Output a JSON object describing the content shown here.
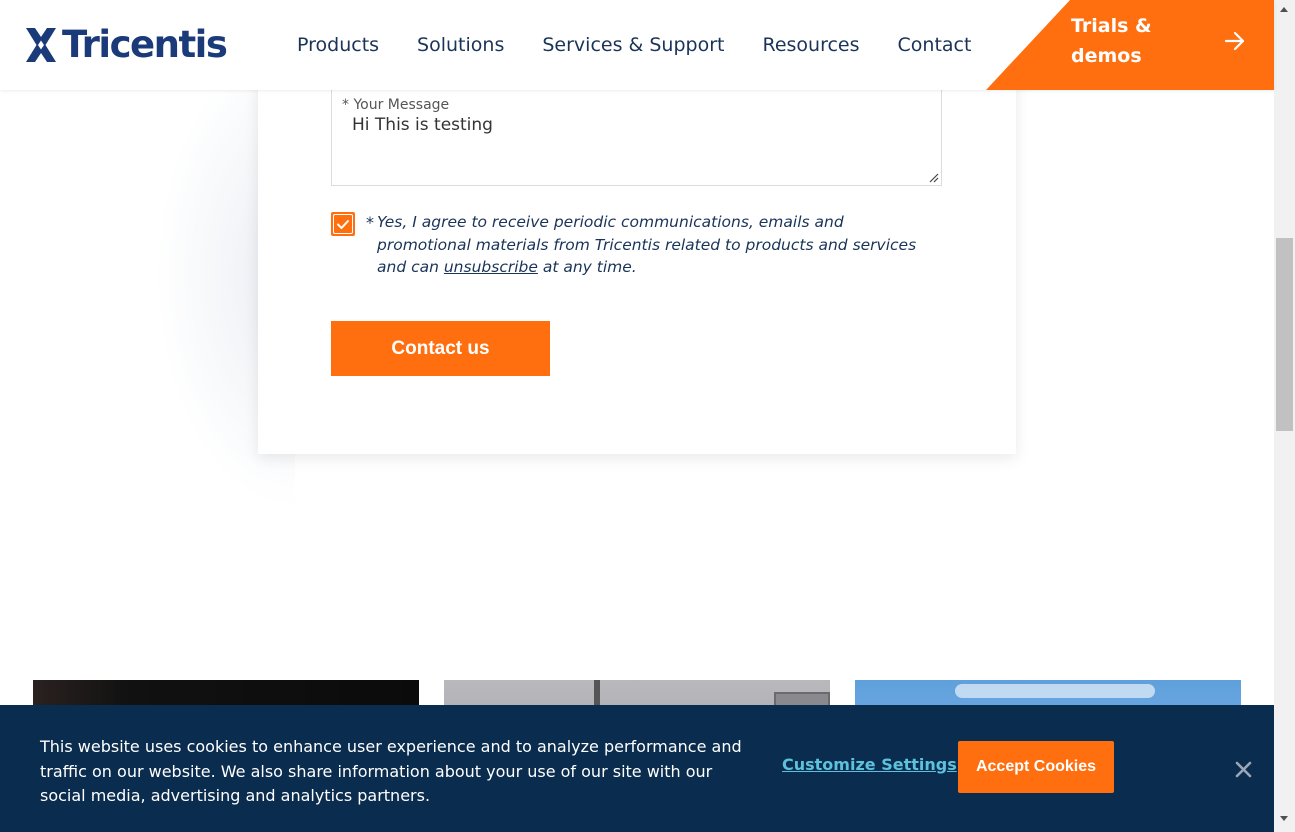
{
  "brand": {
    "name": "Tricentis",
    "logo_color": "#1b3a7a",
    "accent": "#ff6f0f"
  },
  "nav": {
    "items": [
      {
        "label": "Products"
      },
      {
        "label": "Solutions"
      },
      {
        "label": "Services & Support"
      },
      {
        "label": "Resources"
      },
      {
        "label": "Contact"
      }
    ],
    "cta_label": "Trials & demos",
    "cta_icon": "arrow-right-icon"
  },
  "form": {
    "message_label": "Your Message",
    "message_required_mark": "*",
    "message_value": "Hi This is testing",
    "consent_checked": true,
    "consent_required_mark": "*",
    "consent_text_before": "Yes, I agree to receive periodic communications, emails and promotional materials from Tricentis related to products and services and can ",
    "consent_link": "unsubscribe",
    "consent_text_after": " at any time.",
    "submit_label": "Contact us"
  },
  "cookie_banner": {
    "text": "This website uses cookies to enhance user experience and to analyze performance and traffic on our website. We also share information about your use of our site with our social media, advertising and analytics partners.",
    "customize_label": "Customize Settings",
    "accept_label": "Accept Cookies",
    "close_icon": "close-icon",
    "background": "#0a2c4e",
    "link_color": "#5ec1dc"
  }
}
